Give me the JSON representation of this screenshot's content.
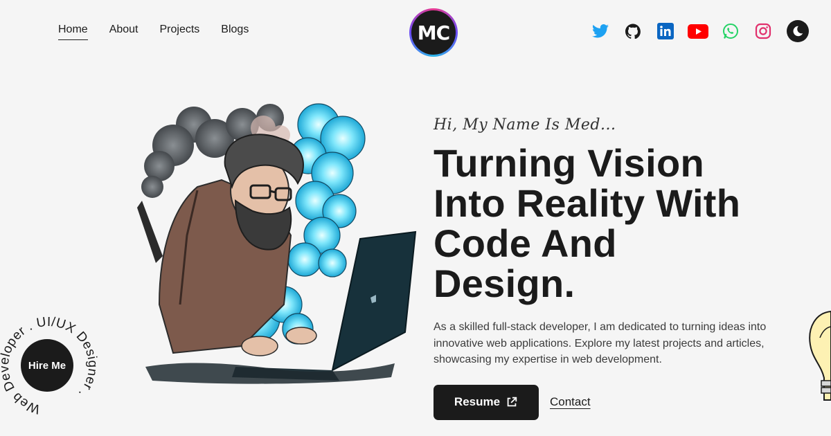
{
  "nav": {
    "items": [
      {
        "label": "Home",
        "active": true
      },
      {
        "label": "About",
        "active": false
      },
      {
        "label": "Projects",
        "active": false
      },
      {
        "label": "Blogs",
        "active": false
      }
    ]
  },
  "logo": {
    "text": "MC"
  },
  "socials": [
    "twitter-icon",
    "github-icon",
    "linkedin-icon",
    "youtube-icon",
    "whatsapp-icon",
    "instagram-icon"
  ],
  "theme_toggle": {
    "icon": "moon-icon"
  },
  "hero": {
    "greeting": "Hi, My Name Is Med...",
    "headline_lines": [
      "Turning Vision",
      "Into Reality With",
      "Code And",
      "Design."
    ],
    "description": "As a skilled full-stack developer, I am dedicated to turning ideas into innovative web applications. Explore my latest projects and articles, showcasing my expertise in web development.",
    "resume_label": "Resume",
    "contact_label": "Contact"
  },
  "hire": {
    "button_label": "Hire Me",
    "ring_text": "Web Developer . UI/UX Designer ."
  },
  "colors": {
    "text": "#1b1b1b",
    "background": "#f5f5f5",
    "twitter": "#1da1f2",
    "linkedin": "#0a66c2",
    "youtube": "#ff0000",
    "whatsapp": "#25d366",
    "instagram": "#e1306c",
    "glow": "#3fd0f0"
  }
}
